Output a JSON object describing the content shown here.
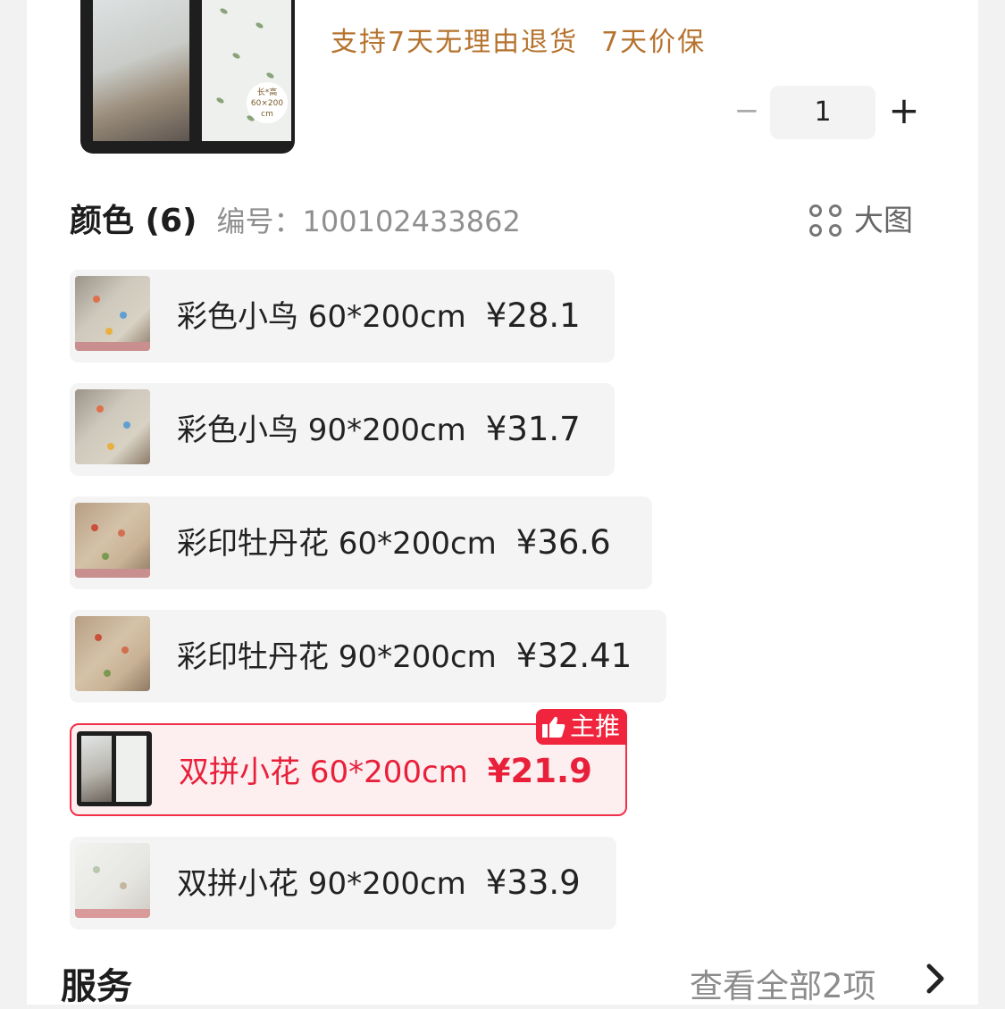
{
  "product": {
    "thumb_tag": "长*高\n60×200\ncm",
    "promises": [
      "支持7天无理由退货",
      "7天价保"
    ]
  },
  "stepper": {
    "minus": "−",
    "quantity": "1",
    "plus": "+"
  },
  "color_section": {
    "title": "颜色 (6)",
    "sku": "编号：100102433862",
    "big_image_label": "大图"
  },
  "options": [
    {
      "name": "彩色小鸟 60*200cm",
      "price": "¥28.1",
      "selected": false
    },
    {
      "name": "彩色小鸟 90*200cm",
      "price": "¥31.7",
      "selected": false
    },
    {
      "name": "彩印牡丹花 60*200cm",
      "price": "¥36.6",
      "selected": false
    },
    {
      "name": "彩印牡丹花 90*200cm",
      "price": "¥32.41",
      "selected": false
    },
    {
      "name": "双拼小花 60*200cm",
      "price": "¥21.9",
      "selected": true,
      "badge": "主推"
    },
    {
      "name": "双拼小花 90*200cm",
      "price": "¥33.9",
      "selected": false
    }
  ],
  "service": {
    "title": "服务",
    "view_all": "查看全部2项"
  },
  "colors": {
    "accent": "#f0253d",
    "promise": "#b5732e"
  }
}
